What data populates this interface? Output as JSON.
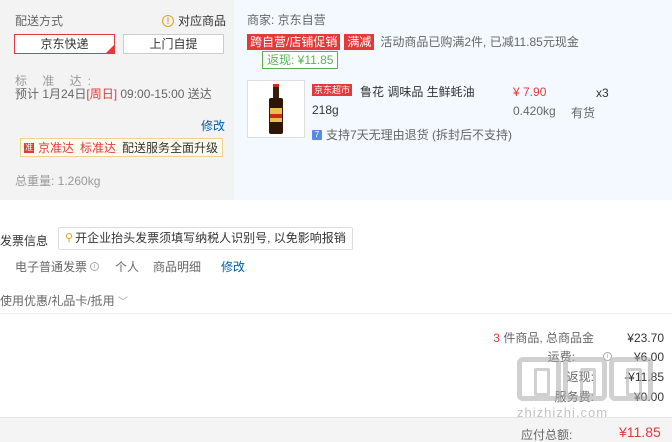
{
  "shipping": {
    "title": "配送方式",
    "matching_link": "对应商品",
    "options": [
      "京东快递",
      "上门自提"
    ],
    "std_label": "标 准 达:",
    "time_prefix": "预计 1月24日",
    "time_day": "[周日]",
    "time_suffix": " 09:00-15:00 送达",
    "modify": "修改",
    "upgrade_brand": "京准达",
    "upgrade_std": "标准达",
    "upgrade_text": "配送服务全面升级",
    "weight": "总重量: 1.260kg"
  },
  "order": {
    "vendor": "商家: 京东自营",
    "tags": [
      "跨自营/店铺促销",
      "满减"
    ],
    "promo_text": "活动商品已购满2件, 已减11.85元现金",
    "rebate": "返现: ¥11.85",
    "product": {
      "channel_tag": "京东超市",
      "name": "鲁花 调味品 生鲜蚝油 218g",
      "price": "¥ 7.90",
      "qty": "x3",
      "weight": "0.420kg",
      "stock": "有货",
      "return_policy": "支持7天无理由退货 (拆封后不支持)"
    }
  },
  "invoice": {
    "title": "发票信息",
    "tip": "开企业抬头发票须填写纳税人识别号, 以免影响报销",
    "type": "电子普通发票",
    "recipient": "个人",
    "content": "商品明细",
    "modify": "修改"
  },
  "coupon": {
    "label": "使用优惠/礼品卡/抵用"
  },
  "summary": {
    "count": "3",
    "items_label": " 件商品, 总商品金",
    "items_total": "¥23.70",
    "freight_label": "运费:",
    "freight": "¥6.00",
    "cashback_label": "返现:",
    "cashback": "-¥11.85",
    "service_label": "服务费:",
    "service": "¥0.00",
    "total_label": "应付总额:",
    "total": "¥11.85"
  },
  "watermark": "zhizhizhi.com"
}
